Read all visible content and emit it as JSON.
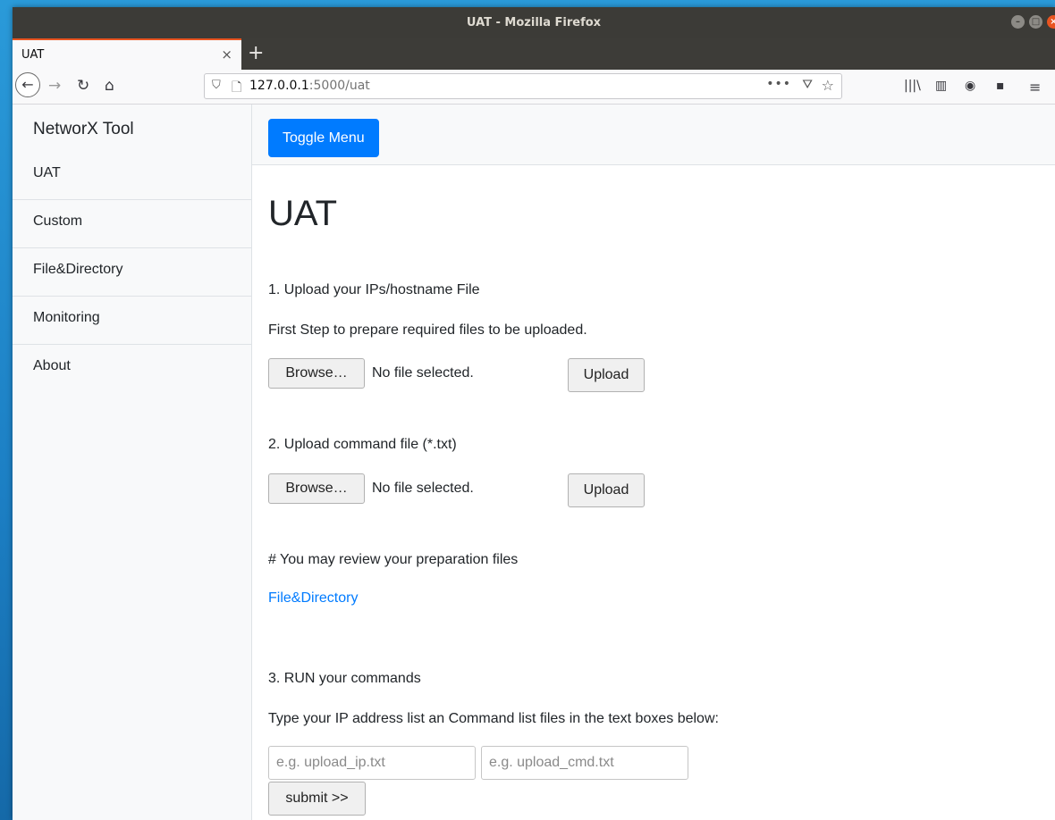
{
  "window": {
    "title": "UAT - Mozilla Firefox"
  },
  "browser": {
    "tab_label": "UAT",
    "tab_close": "×",
    "new_tab": "+",
    "url_host": "127.0.0.1",
    "url_rest": ":5000/uat",
    "icons": [
      "back-icon",
      "forward-icon",
      "reload-icon",
      "home-icon",
      "shield-icon",
      "page-icon",
      "more-icon",
      "pocket-icon",
      "star-icon",
      "library-icon",
      "sidebar-icon",
      "account-icon",
      "extension-icon",
      "menu-icon"
    ]
  },
  "sidebar": {
    "heading": "NetworX Tool",
    "items": [
      {
        "label": "UAT"
      },
      {
        "label": "Custom"
      },
      {
        "label": "File&Directory"
      },
      {
        "label": "Monitoring"
      },
      {
        "label": "About"
      }
    ]
  },
  "topbar": {
    "toggle_label": "Toggle Menu"
  },
  "main": {
    "title": "UAT",
    "step1_heading": "1. Upload your IPs/hostname File",
    "step1_desc": "First Step to prepare required files to be uploaded.",
    "step2_heading": "2. Upload command file (*.txt)",
    "browse_label": "Browse…",
    "no_file": "No file selected.",
    "upload_label": "Upload",
    "review_text": "# You may review your preparation files",
    "review_link": "File&Directory",
    "step3_heading": "3. RUN your commands",
    "step3_desc": "Type your IP address list an Command list files in the text boxes below:",
    "ip_placeholder": "e.g. upload_ip.txt",
    "cmd_placeholder": "e.g. upload_cmd.txt",
    "submit_label": "submit >>"
  },
  "colors": {
    "accent": "#007bff",
    "tab_highlight": "#e95420",
    "titlebar": "#3c3b37"
  }
}
